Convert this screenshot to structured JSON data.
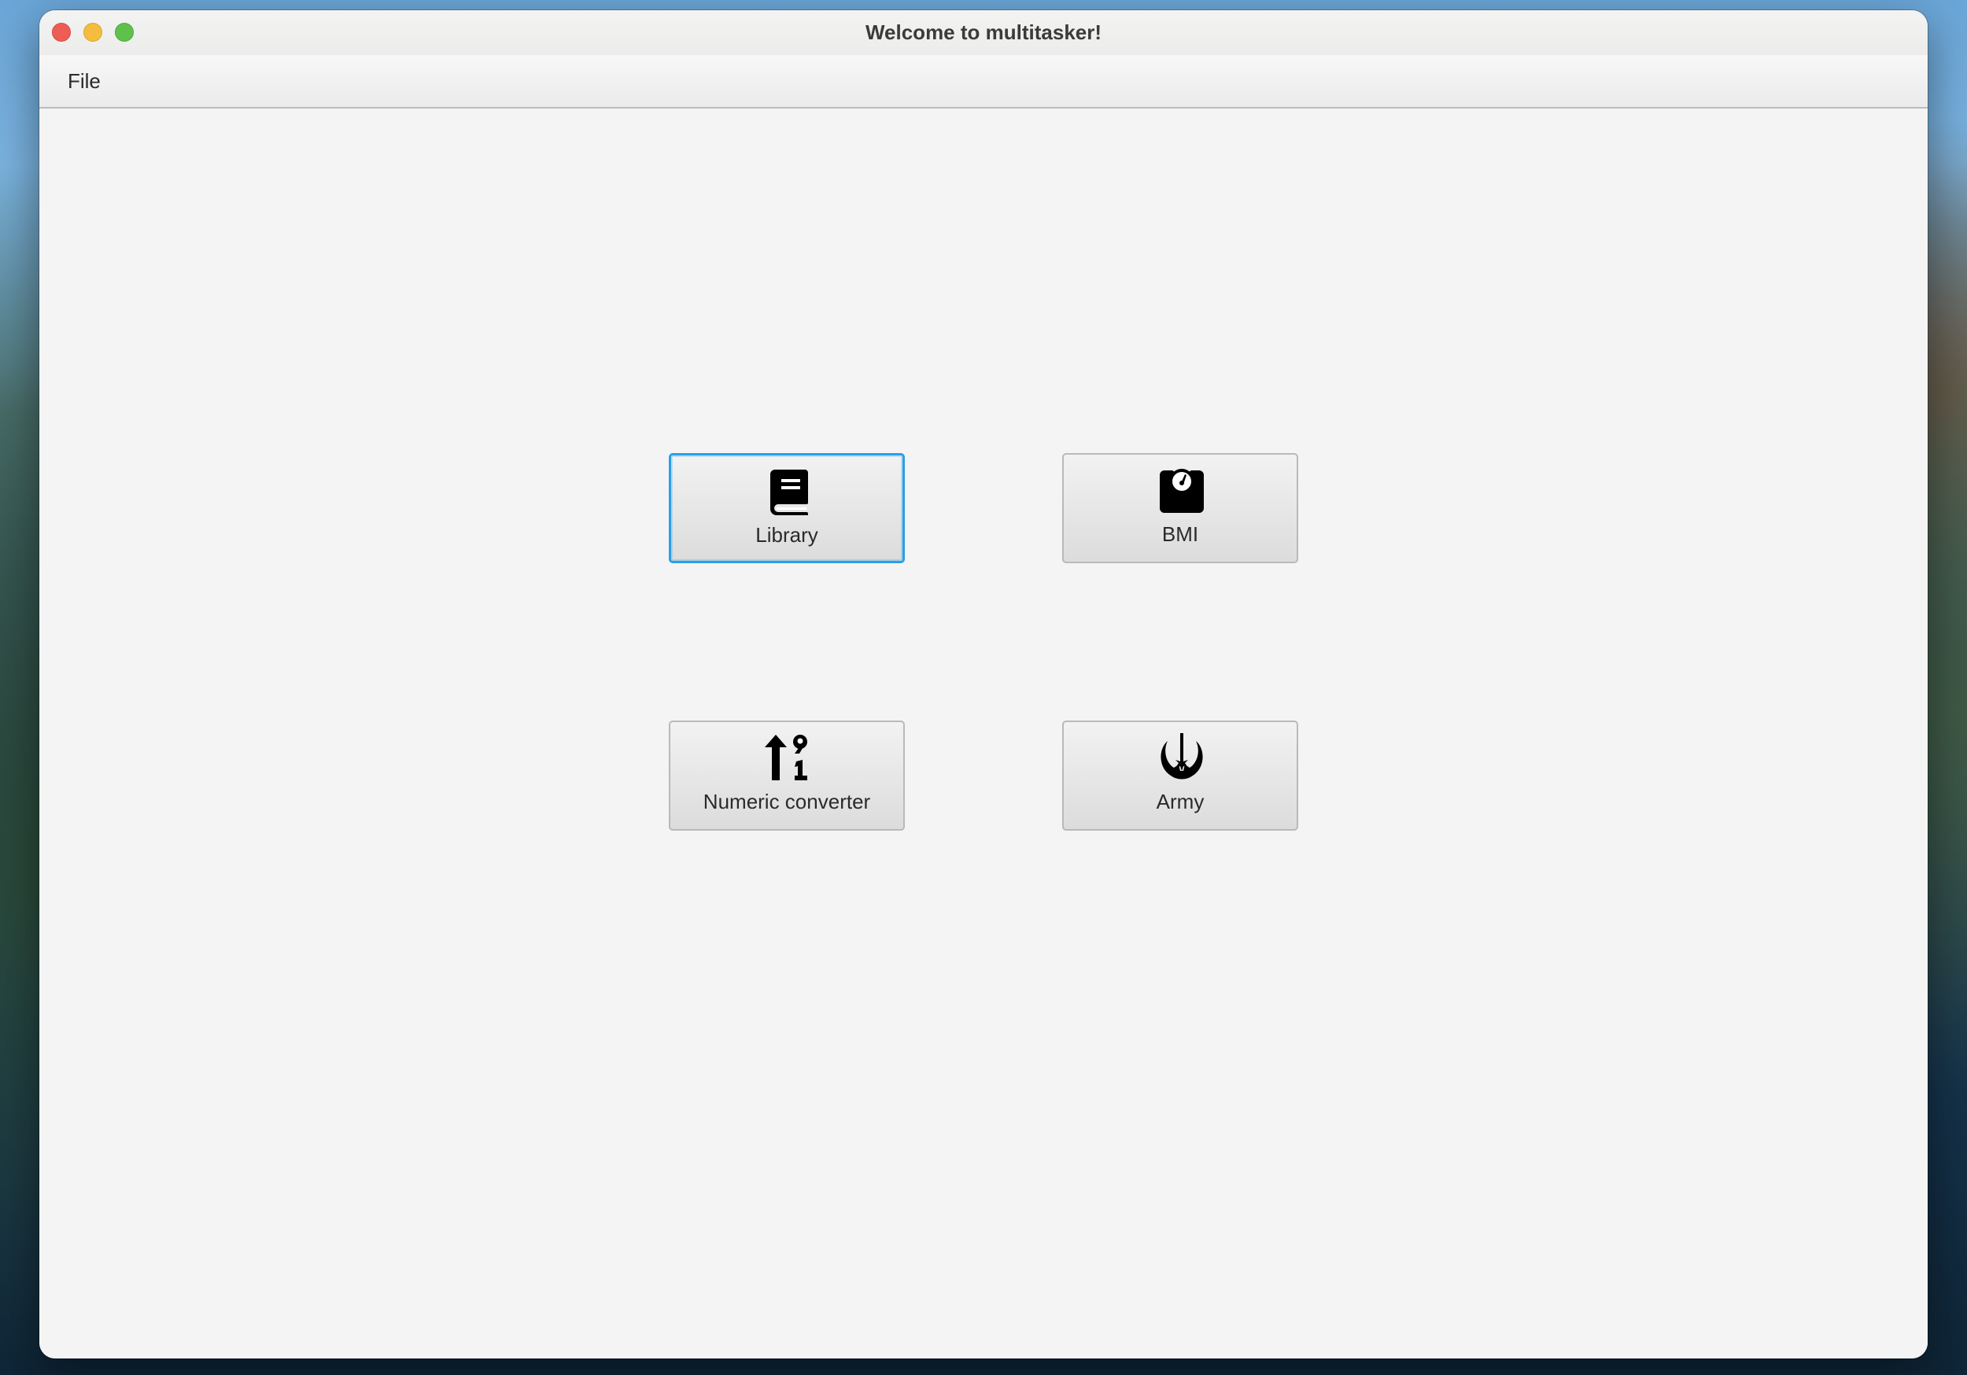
{
  "window": {
    "title": "Welcome to multitasker!",
    "controls": [
      "close",
      "minimize",
      "maximize"
    ]
  },
  "menubar": {
    "items": [
      {
        "label": "File"
      }
    ]
  },
  "tiles": [
    {
      "label": "Library",
      "icon": "book-icon",
      "focused": true
    },
    {
      "label": "BMI",
      "icon": "weight-scale-icon",
      "focused": false
    },
    {
      "label": "Numeric converter",
      "icon": "sort-numeric-up-icon",
      "focused": false
    },
    {
      "label": "Army",
      "icon": "jedi-order-icon",
      "focused": false
    }
  ],
  "colors": {
    "focus_ring": "#2aa0e6",
    "traffic_close": "#ee5d55",
    "traffic_minimize": "#f4bd3f",
    "traffic_maximize": "#5fc14b"
  }
}
